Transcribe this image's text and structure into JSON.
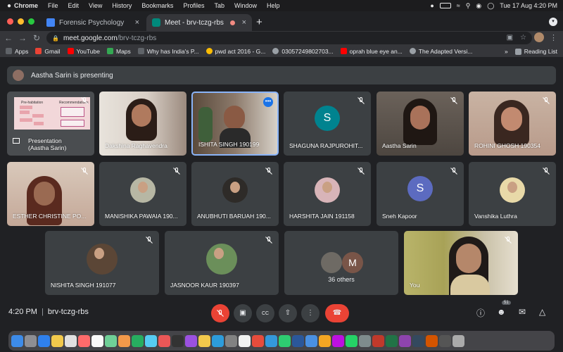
{
  "menubar": {
    "app": "Chrome",
    "items": [
      "File",
      "Edit",
      "View",
      "History",
      "Bookmarks",
      "Profiles",
      "Tab",
      "Window",
      "Help"
    ],
    "date_time": "Tue 17 Aug  4:20 PM"
  },
  "tabs": [
    {
      "label": "Forensic Psychology",
      "favicon_color": "#4285f4"
    },
    {
      "label": "Meet - brv-tczg-rbs",
      "favicon_color": "#00897b"
    }
  ],
  "address_bar": {
    "host": "meet.google.com",
    "path": "/brv-tczg-rbs"
  },
  "bookmarks": [
    {
      "label": "Apps",
      "color": "#5f6368"
    },
    {
      "label": "Gmail",
      "color": "#ea4335"
    },
    {
      "label": "YouTube",
      "color": "#ff0000"
    },
    {
      "label": "Maps",
      "color": "#34a853"
    },
    {
      "label": "Why has India's P...",
      "color": "#5f6368"
    },
    {
      "label": "pwd act 2016 - G...",
      "color": "#fbbc04"
    },
    {
      "label": "03057249802703...",
      "color": "#9aa0a6"
    },
    {
      "label": "oprah blue eye an...",
      "color": "#ff0000"
    },
    {
      "label": "The Adapted Versi...",
      "color": "#9aa0a6"
    }
  ],
  "bookmarks_overflow": "»",
  "reading_list": "Reading List",
  "presenting_banner": "Aastha Sarin is presenting",
  "slide": {
    "left_title": "Pre-habitation",
    "right_title": "Recommendations"
  },
  "tiles": [
    {
      "name": "Presentation\n(Aastha Sarin)",
      "kind": "presentation"
    },
    {
      "name": "Dakshina Raghavendra",
      "kind": "video"
    },
    {
      "name": "ISHITA SINGH 190199",
      "kind": "video"
    },
    {
      "name": "SHAGUNA RAJPUROHIT...",
      "kind": "letter",
      "letter": "S",
      "color": "#00838f"
    },
    {
      "name": "Aastha Sarin",
      "kind": "video"
    },
    {
      "name": "ROHINI GHOSH 190354",
      "kind": "video"
    },
    {
      "name": "ESTHER CHRISTINE PO...",
      "kind": "video"
    },
    {
      "name": "MANISHIKA PAWAIA 190...",
      "kind": "avatar"
    },
    {
      "name": "ANUBHUTI BARUAH 190...",
      "kind": "avatar"
    },
    {
      "name": "HARSHITA JAIN 191158",
      "kind": "avatar"
    },
    {
      "name": "Sneh Kapoor",
      "kind": "letter",
      "letter": "S",
      "color": "#5c6bc0"
    },
    {
      "name": "Vanshika Luthra",
      "kind": "avatar"
    },
    {
      "name": "NISHITA SINGH 191077",
      "kind": "avatar"
    },
    {
      "name": "JASNOOR KAUR 190397",
      "kind": "avatar"
    },
    {
      "name": "36 others",
      "kind": "group",
      "letter": "M",
      "color": "#795548"
    },
    {
      "name": "You",
      "kind": "video"
    }
  ],
  "meeting": {
    "time": "4:20 PM",
    "code": "brv-tczg-rbs",
    "participant_count": "51"
  }
}
